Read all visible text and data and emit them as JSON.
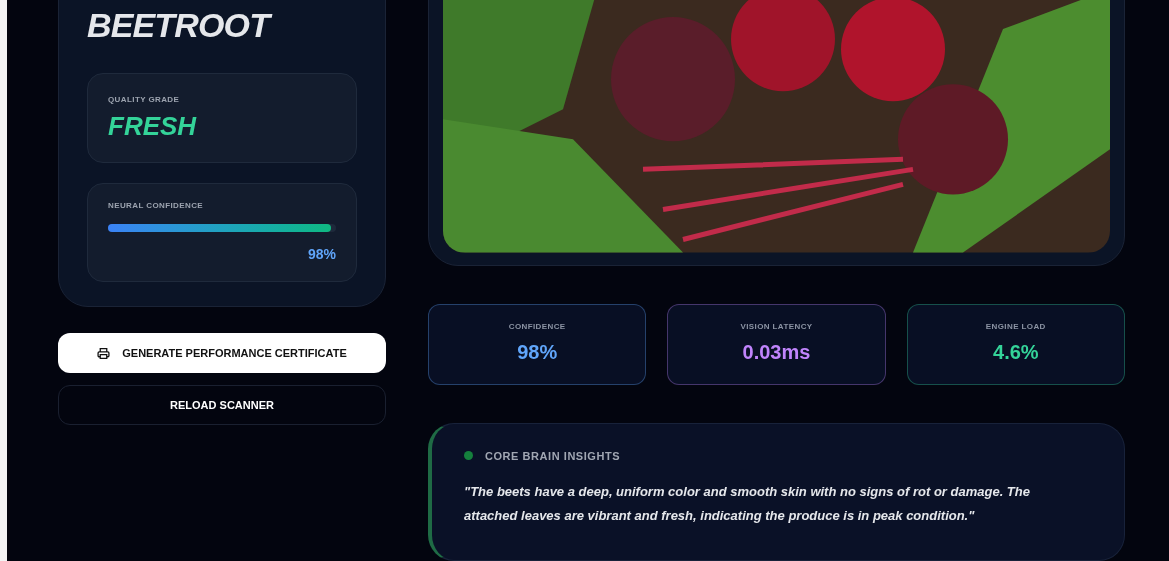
{
  "result": {
    "title": "BEETROOT",
    "grade_label": "QUALITY GRADE",
    "grade": "FRESH",
    "confidence": {
      "label": "NEURAL CONFIDENCE",
      "level": 0.98,
      "reading": "98%"
    }
  },
  "buttons": [
    {
      "label": "GENERATE PERFORMANCE CERTIFICATE",
      "kind": "primary"
    },
    {
      "label": "RELOAD SCANNER",
      "kind": "secondary"
    }
  ],
  "stats": [
    {
      "label": "CONFIDENCE",
      "value": "98%",
      "color": "#60a5fa"
    },
    {
      "label": "VISION LATENCY",
      "value": "0.03ms",
      "color": "#c084fc"
    },
    {
      "label": "ENGINE LOAD",
      "value": "4.6%",
      "color": "#34d399"
    }
  ],
  "insights": {
    "title": "CORE BRAIN INSIGHTS",
    "text": "\"The beets have a deep, uniform color and smooth skin with no signs of rot or damage. The attached leaves are vibrant and fresh, indicating the produce is in peak condition.\""
  }
}
